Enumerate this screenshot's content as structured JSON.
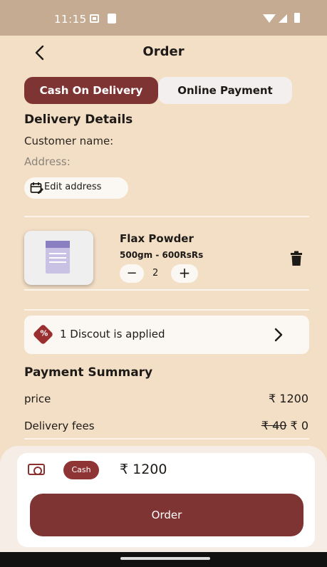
{
  "status_bar": {
    "time": "11:15"
  },
  "header": {
    "title": "Order"
  },
  "payment_tabs": [
    {
      "label": "Cash On Delivery",
      "selected": true
    },
    {
      "label": "Online Payment",
      "selected": false
    }
  ],
  "delivery": {
    "heading": "Delivery Details",
    "customer_label": "Customer name:",
    "address_label": "Address:",
    "edit_label": "Edit address"
  },
  "product": {
    "pack_label": "Flax Powder",
    "name": "Flax Powder",
    "variant": "500gm - 600RsRs",
    "quantity": "2",
    "minus": "−",
    "plus": "+"
  },
  "discount": {
    "label": "1 Discout is applied"
  },
  "summary": {
    "heading": "Payment Summary",
    "price_label": "price",
    "price_value": "₹ 1200",
    "delivery_label": "Delivery fees",
    "delivery_old": "₹ 40",
    "delivery_new": "₹ 0"
  },
  "bottom": {
    "method": "Cash",
    "total": "₹ 1200",
    "order_label": "Order"
  },
  "colors": {
    "primary": "#7f3434",
    "background": "#f3dfc6",
    "card": "#fbf7f3",
    "statusbar": "#c5ab92"
  }
}
